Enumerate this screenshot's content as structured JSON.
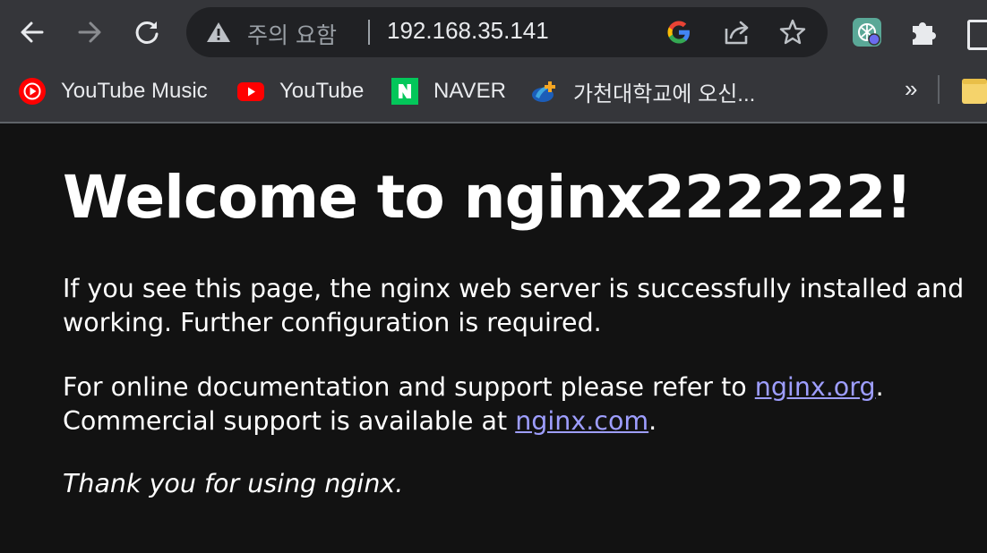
{
  "browser": {
    "nav": {
      "back_icon": "arrow-left-icon",
      "forward_icon": "arrow-right-icon",
      "reload_icon": "reload-icon"
    },
    "omnibox": {
      "security_status": "주의 요함",
      "url": "192.168.35.141",
      "warning_icon": "warning-triangle-icon",
      "google_icon": "google-icon",
      "share_icon": "share-icon",
      "bookmark_icon": "star-icon"
    },
    "extensions": [
      "chatgpt-extension-icon",
      "puzzle-icon"
    ],
    "bookmarks": [
      {
        "label": "YouTube Music",
        "icon": "youtube-music-icon"
      },
      {
        "label": "YouTube",
        "icon": "youtube-icon"
      },
      {
        "label": "NAVER",
        "icon": "naver-icon"
      },
      {
        "label": "가천대학교에 오신...",
        "icon": "gachon-icon"
      }
    ],
    "bookmarks_more": "»"
  },
  "page": {
    "heading": "Welcome to nginx222222!",
    "para1_line1": "If you see this page, the nginx web server is successfully installed and",
    "para1_line2": "working. Further configuration is required.",
    "para2_prefix": "For online documentation and support please refer to ",
    "para2_link1": "nginx.org",
    "para2_suffix1": ".",
    "para2_line2_prefix": "Commercial support is available at ",
    "para2_link2": "nginx.com",
    "para2_suffix2": ".",
    "thanks": "Thank you for using nginx."
  },
  "colors": {
    "toolbar_bg": "#35363a",
    "omnibox_bg": "#202124",
    "page_bg": "#121212",
    "link": "#9e9eff",
    "text": "#ffffff"
  }
}
